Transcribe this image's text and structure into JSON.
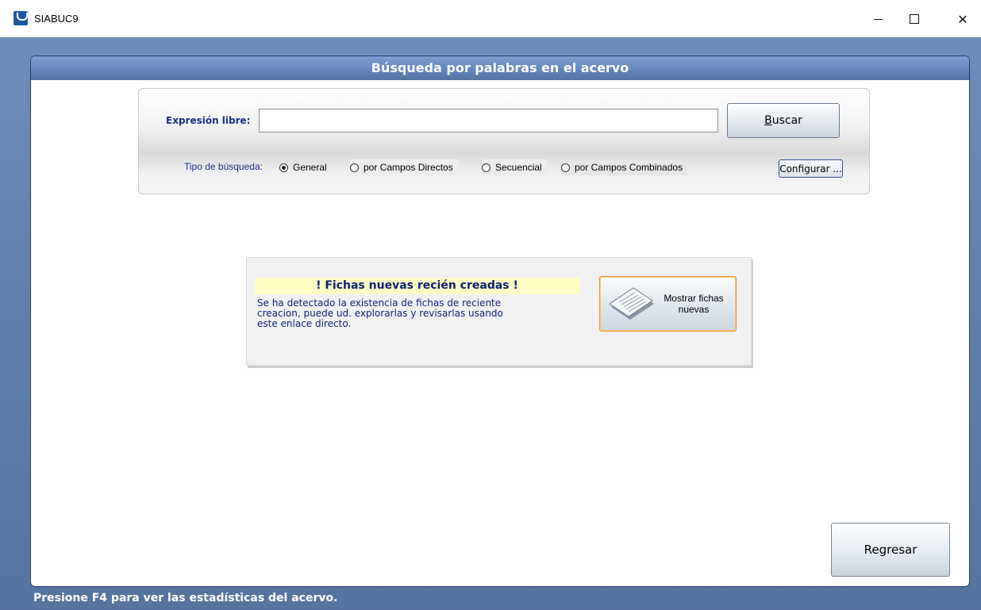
{
  "window": {
    "title": "SIABUC9",
    "icons": {
      "app": "siabuc-logo-icon",
      "minimize": "minimize-icon",
      "maximize": "maximize-icon",
      "close": "close-icon"
    },
    "close_glyph": "✕"
  },
  "panel": {
    "header": "Búsqueda por palabras en el acervo"
  },
  "search": {
    "expr_label": "Expresión libre:",
    "expr_value": "",
    "buscar_accel": "B",
    "buscar_rest": "uscar",
    "tipo_label": "Tipo de búsqueda:",
    "tipos": [
      {
        "label": "General",
        "selected": true
      },
      {
        "label": "por Campos Directos",
        "selected": false
      },
      {
        "label": "Secuencial",
        "selected": false
      },
      {
        "label": "por Campos Combinados",
        "selected": false
      }
    ],
    "configurar_label": "Configurar ..."
  },
  "fichas": {
    "title": "! Fichas nuevas recién creadas !",
    "text_lines": [
      "Se ha detectado la existencia de fichas de reciente",
      "creacion, puede ud. explorarlas y revisarlas usando",
      "este enlace directo."
    ],
    "button_lines": [
      "Mostrar fichas",
      "nuevas"
    ],
    "button_icon": "document-icon",
    "title_bg": "#fdfdc3",
    "text_color": "#101f78"
  },
  "regresar_label": "Regresar",
  "status_text": "Presione F4 para ver las estadísticas del acervo.",
  "colors": {
    "frame": "#5d7caa",
    "header_text": "#ffffff",
    "label_blue": "#1c2f8a",
    "highlight_border": "#e39a2e"
  }
}
